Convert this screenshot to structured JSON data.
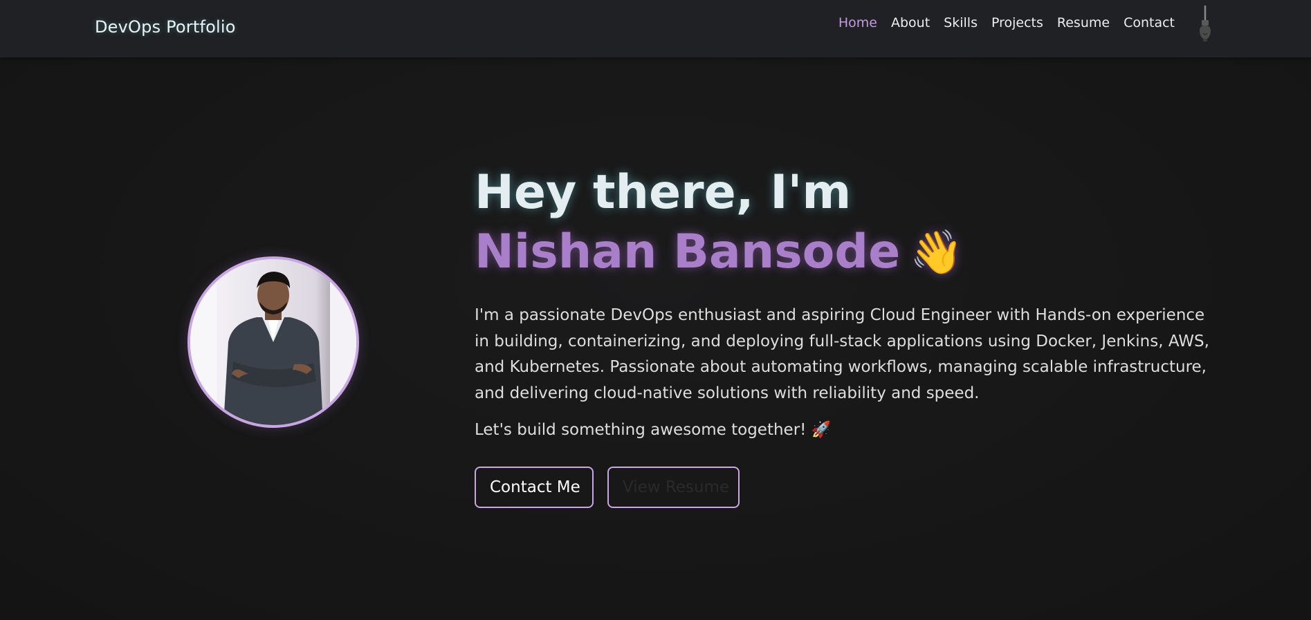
{
  "nav": {
    "brand": "DevOps Portfolio",
    "links": [
      "Home",
      "About",
      "Skills",
      "Projects",
      "Resume",
      "Contact"
    ],
    "active": "Home",
    "active_color": "#c49ae0",
    "theme_toggle_icon": "lightbulb-icon"
  },
  "hero": {
    "greeting": "Hey there, I'm",
    "name": "Nishan Bansode",
    "wave_emoji": "👋",
    "bio": "I'm a passionate DevOps enthusiast and aspiring Cloud Engineer with Hands-on experience in building, containerizing, and deploying full-stack applications using Docker, Jenkins, AWS, and Kubernetes. Passionate about automating workflows, managing scalable infrastructure, and delivering cloud-native solutions with reliability and speed.",
    "tagline": "Let's build something awesome together! 🚀",
    "buttons": {
      "contact": "Contact Me",
      "resume": "View Resume"
    },
    "accent_color": "#a97fca",
    "border_color": "#caa8e6"
  }
}
